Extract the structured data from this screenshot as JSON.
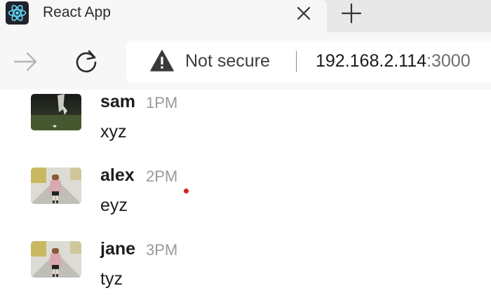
{
  "browser": {
    "tab": {
      "title": "React App",
      "favicon": "react-logo-icon",
      "close_icon": "close-icon"
    },
    "new_tab_icon": "plus-icon",
    "toolbar": {
      "forward_icon": "arrow-right-icon",
      "reload_icon": "reload-icon",
      "security_icon": "warning-triangle-icon",
      "security_label": "Not secure",
      "url_host": "192.168.2.114",
      "url_port": ":3000"
    }
  },
  "messages": [
    {
      "author": "sam",
      "time": "1PM",
      "text": "xyz"
    },
    {
      "author": "alex",
      "time": "2PM",
      "text": "eyz"
    },
    {
      "author": "jane",
      "time": "3PM",
      "text": "tyz"
    }
  ],
  "colors": {
    "favicon_bg": "#20232a",
    "react_blue": "#61dafb",
    "indicator_dot": "#dd1f1f"
  }
}
